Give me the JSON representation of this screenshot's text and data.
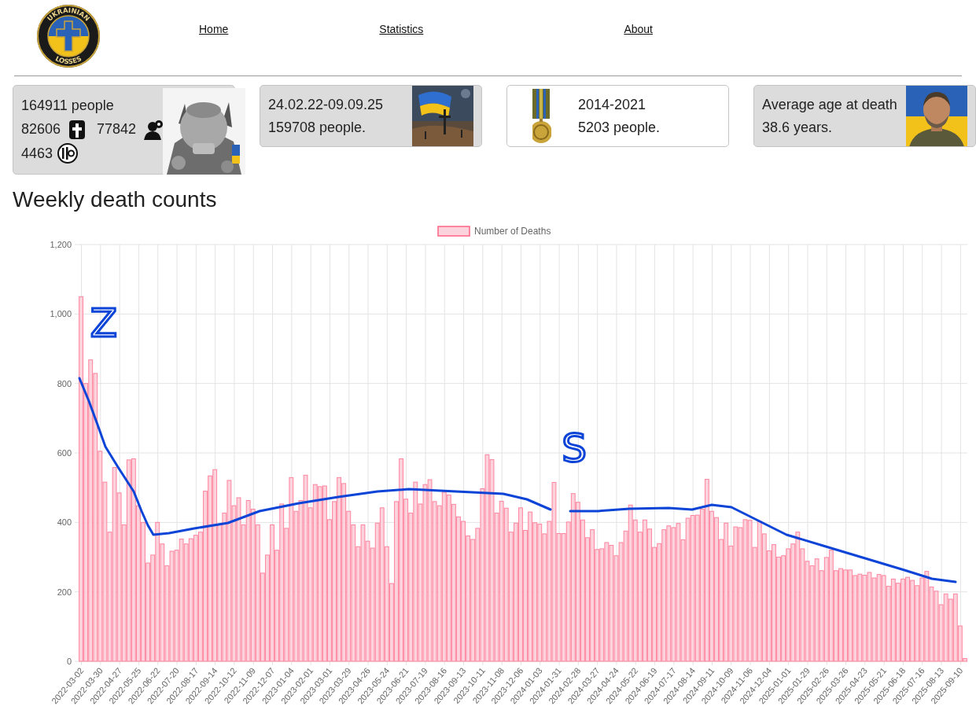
{
  "logo": {
    "top_text": "UKRAINIAN",
    "bottom_text": "LOSSES"
  },
  "nav": [
    {
      "label": "Home"
    },
    {
      "label": "Statistics"
    },
    {
      "label": "About"
    }
  ],
  "cards": [
    {
      "kind": "totals",
      "title": "164911 people",
      "counts": [
        "82606",
        "77842",
        "4463"
      ]
    },
    {
      "kind": "period",
      "lines": [
        "24.02.22-09.09.25",
        "159708 people."
      ]
    },
    {
      "kind": "prewar",
      "lines": [
        "2014-2021",
        "5203 people."
      ]
    },
    {
      "kind": "age",
      "lines": [
        "Average age at death",
        "38.6 years."
      ]
    }
  ],
  "section_title": "Weekly death counts",
  "chart_data": {
    "type": "bar",
    "grid": true,
    "categories": [
      "2022-03-02",
      null,
      null,
      null,
      "2022-03-30",
      null,
      null,
      null,
      "2022-04-27",
      null,
      null,
      null,
      "2022-05-25",
      null,
      null,
      null,
      "2022-06-22",
      null,
      null,
      null,
      "2022-07-20",
      null,
      null,
      null,
      "2022-08-17",
      null,
      null,
      null,
      "2022-09-14",
      null,
      null,
      null,
      "2022-10-12",
      null,
      null,
      null,
      "2022-11-09",
      null,
      null,
      null,
      "2022-12-07",
      null,
      null,
      null,
      "2023-01-04",
      null,
      null,
      null,
      "2023-02-01",
      null,
      null,
      null,
      "2023-03-01",
      null,
      null,
      null,
      "2023-03-29",
      null,
      null,
      null,
      "2023-04-26",
      null,
      null,
      null,
      "2023-05-24",
      null,
      null,
      null,
      "2023-06-21",
      null,
      null,
      null,
      "2023-07-19",
      null,
      null,
      null,
      "2023-08-16",
      null,
      null,
      null,
      "2023-09-13",
      null,
      null,
      null,
      "2023-10-11",
      null,
      null,
      null,
      "2023-11-08",
      null,
      null,
      null,
      "2023-12-06",
      null,
      null,
      null,
      "2024-01-03",
      null,
      null,
      null,
      "2024-01-31",
      null,
      null,
      null,
      "2024-02-28",
      null,
      null,
      null,
      "2024-03-27",
      null,
      null,
      null,
      "2024-04-24",
      null,
      null,
      null,
      "2024-05-22",
      null,
      null,
      null,
      "2024-06-19",
      null,
      null,
      null,
      "2024-07-17",
      null,
      null,
      null,
      "2024-08-14",
      null,
      null,
      null,
      "2024-09-11",
      null,
      null,
      null,
      "2024-10-09",
      null,
      null,
      null,
      "2024-11-06",
      null,
      null,
      null,
      "2024-12-04",
      null,
      null,
      null,
      "2025-01-01",
      null,
      null,
      null,
      "2025-01-29",
      null,
      null,
      null,
      "2025-02-26",
      null,
      null,
      null,
      "2025-03-26",
      null,
      null,
      null,
      "2025-04-23",
      null,
      null,
      null,
      "2025-05-21",
      null,
      null,
      null,
      "2025-06-18",
      null,
      null,
      null,
      "2025-07-16",
      null,
      null,
      null,
      "2025-08-13",
      null,
      null,
      null,
      "2025-09-10",
      null
    ],
    "series": [
      {
        "name": "Number of Deaths",
        "color": "#ff6384",
        "values": [
          1050,
          800,
          868,
          829,
          605,
          516,
          372,
          558,
          485,
          393,
          580,
          583,
          448,
          400,
          283,
          306,
          400,
          338,
          275,
          317,
          320,
          352,
          338,
          353,
          363,
          372,
          490,
          534,
          552,
          393,
          427,
          521,
          448,
          471,
          393,
          463,
          438,
          393,
          254,
          306,
          393,
          320,
          453,
          383,
          529,
          432,
          463,
          536,
          442,
          509,
          503,
          505,
          408,
          460,
          529,
          512,
          432,
          393,
          330,
          393,
          346,
          326,
          398,
          442,
          330,
          224,
          460,
          583,
          467,
          427,
          516,
          453,
          509,
          523,
          460,
          448,
          487,
          479,
          452,
          416,
          403,
          361,
          351,
          383,
          497,
          595,
          581,
          427,
          461,
          441,
          372,
          398,
          442,
          377,
          430,
          399,
          395,
          367,
          403,
          515,
          368,
          368,
          401,
          483,
          458,
          407,
          356,
          379,
          322,
          324,
          342,
          334,
          304,
          342,
          375,
          450,
          407,
          372,
          407,
          381,
          328,
          339,
          379,
          390,
          385,
          397,
          350,
          412,
          420,
          421,
          438,
          524,
          432,
          414,
          351,
          398,
          332,
          387,
          385,
          408,
          406,
          328,
          403,
          367,
          318,
          336,
          300,
          304,
          324,
          338,
          372,
          324,
          288,
          275,
          295,
          261,
          299,
          320,
          261,
          267,
          263,
          263,
          247,
          251,
          248,
          256,
          240,
          250,
          247,
          216,
          237,
          225,
          237,
          242,
          233,
          218,
          240,
          259,
          214,
          202,
          163,
          194,
          179,
          194,
          102,
          8
        ]
      }
    ],
    "ylim": [
      0,
      1200
    ],
    "yticks": [
      {
        "value": 0,
        "label": "0"
      },
      {
        "value": 200,
        "label": "200"
      },
      {
        "value": 400,
        "label": "400"
      },
      {
        "value": 600,
        "label": "600"
      },
      {
        "value": 800,
        "label": "800"
      },
      {
        "value": 1000,
        "label": "1,000"
      },
      {
        "value": 1200,
        "label": "1,200"
      }
    ]
  },
  "handwritten_notes": [
    "Z",
    "S"
  ]
}
